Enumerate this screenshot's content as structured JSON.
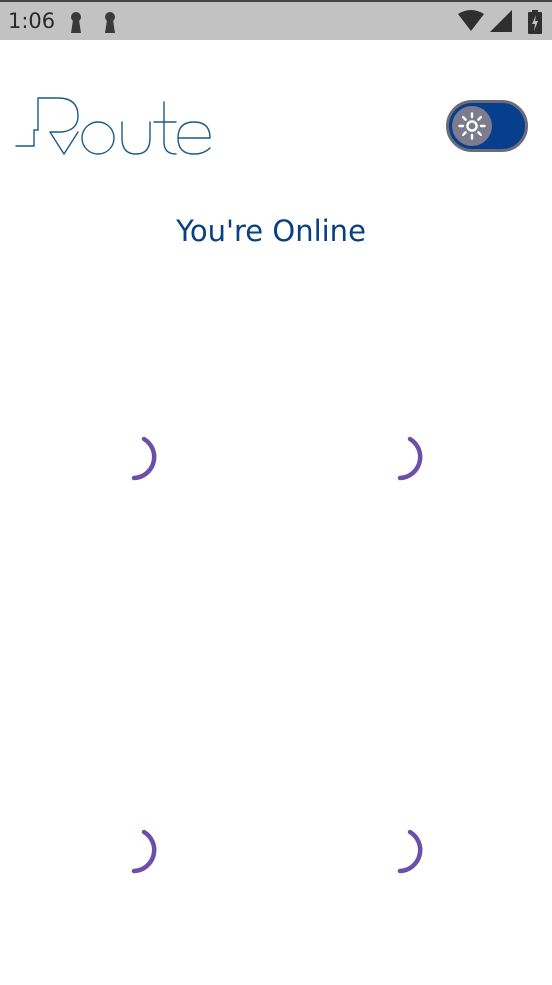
{
  "status_bar": {
    "time": "1:06",
    "icons": [
      "keyhole-notification-icon",
      "keyhole-notification-icon",
      "wifi-icon",
      "cell-signal-icon",
      "battery-charging-icon"
    ]
  },
  "header": {
    "logo_text": "Route",
    "theme_toggle": {
      "icon": "sun-icon",
      "state": "on"
    }
  },
  "main": {
    "connection_status": "You're Online",
    "loading_indicators": 4
  },
  "colors": {
    "accent_text": "#0a4080",
    "toggle_track": "#073f8c",
    "spinner": "#6b4fa8",
    "status_bar": "#c2c2c2"
  }
}
